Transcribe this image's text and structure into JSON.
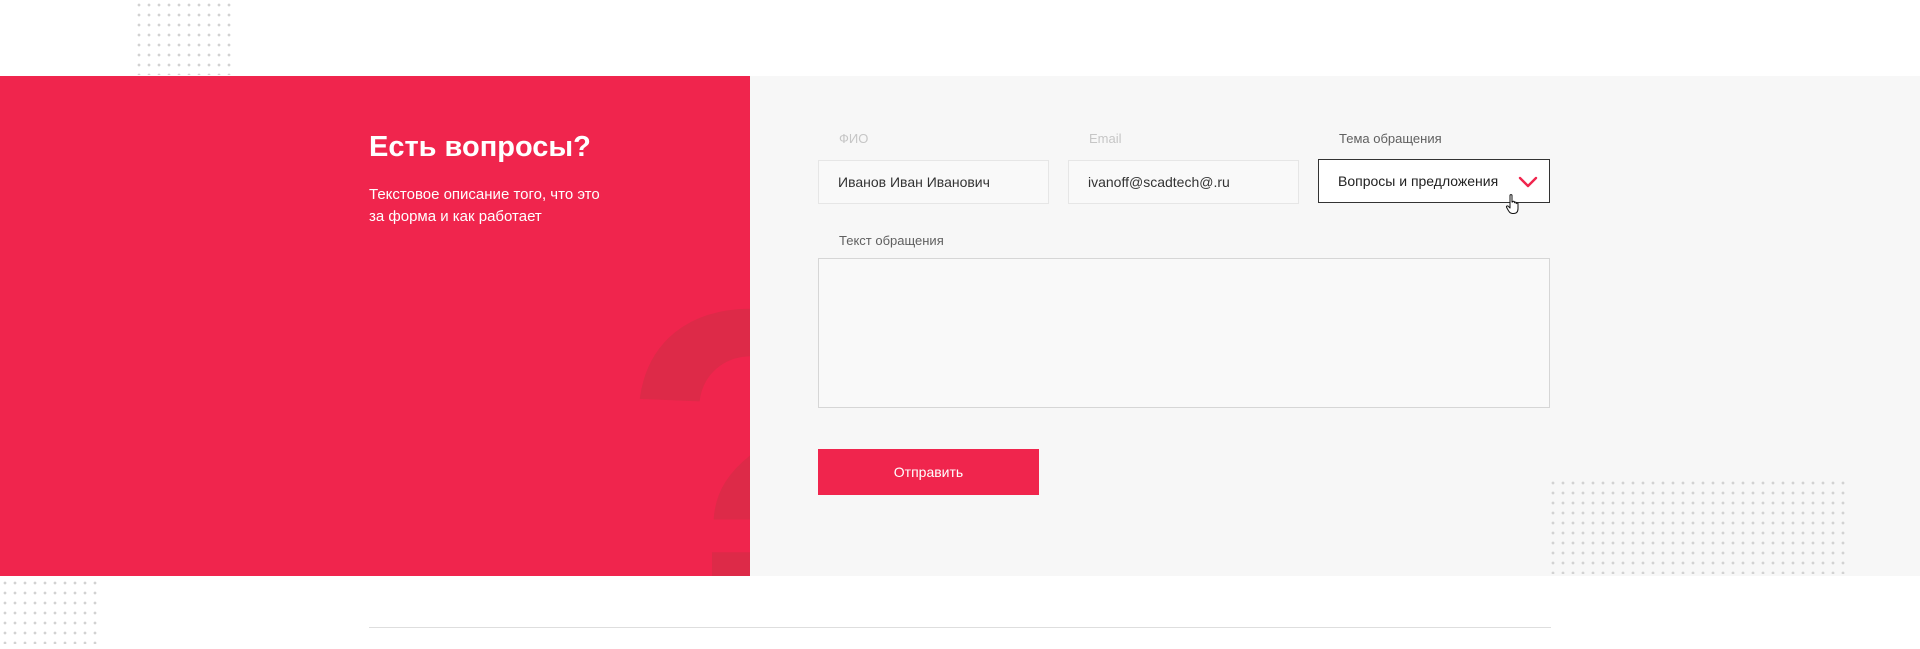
{
  "colors": {
    "accent": "#f0254d",
    "panel_background": "#f7f7f7"
  },
  "left": {
    "title": "Есть вопросы?",
    "description": "Текстовое описание того, что это за форма и как работает",
    "decoration_glyph": "?"
  },
  "form": {
    "fio": {
      "label": "ФИО",
      "value": "Иванов Иван Иванович"
    },
    "email": {
      "label": "Email",
      "value": "ivanoff@scadtech@.ru"
    },
    "topic": {
      "label": "Тема обращения",
      "selected": "Вопросы и предложения"
    },
    "message": {
      "label": "Текст обращения",
      "value": ""
    },
    "submit_label": "Отправить"
  },
  "icons": {
    "select_arrow": "chevron-down-icon",
    "pointer": "hand-pointer-icon"
  }
}
